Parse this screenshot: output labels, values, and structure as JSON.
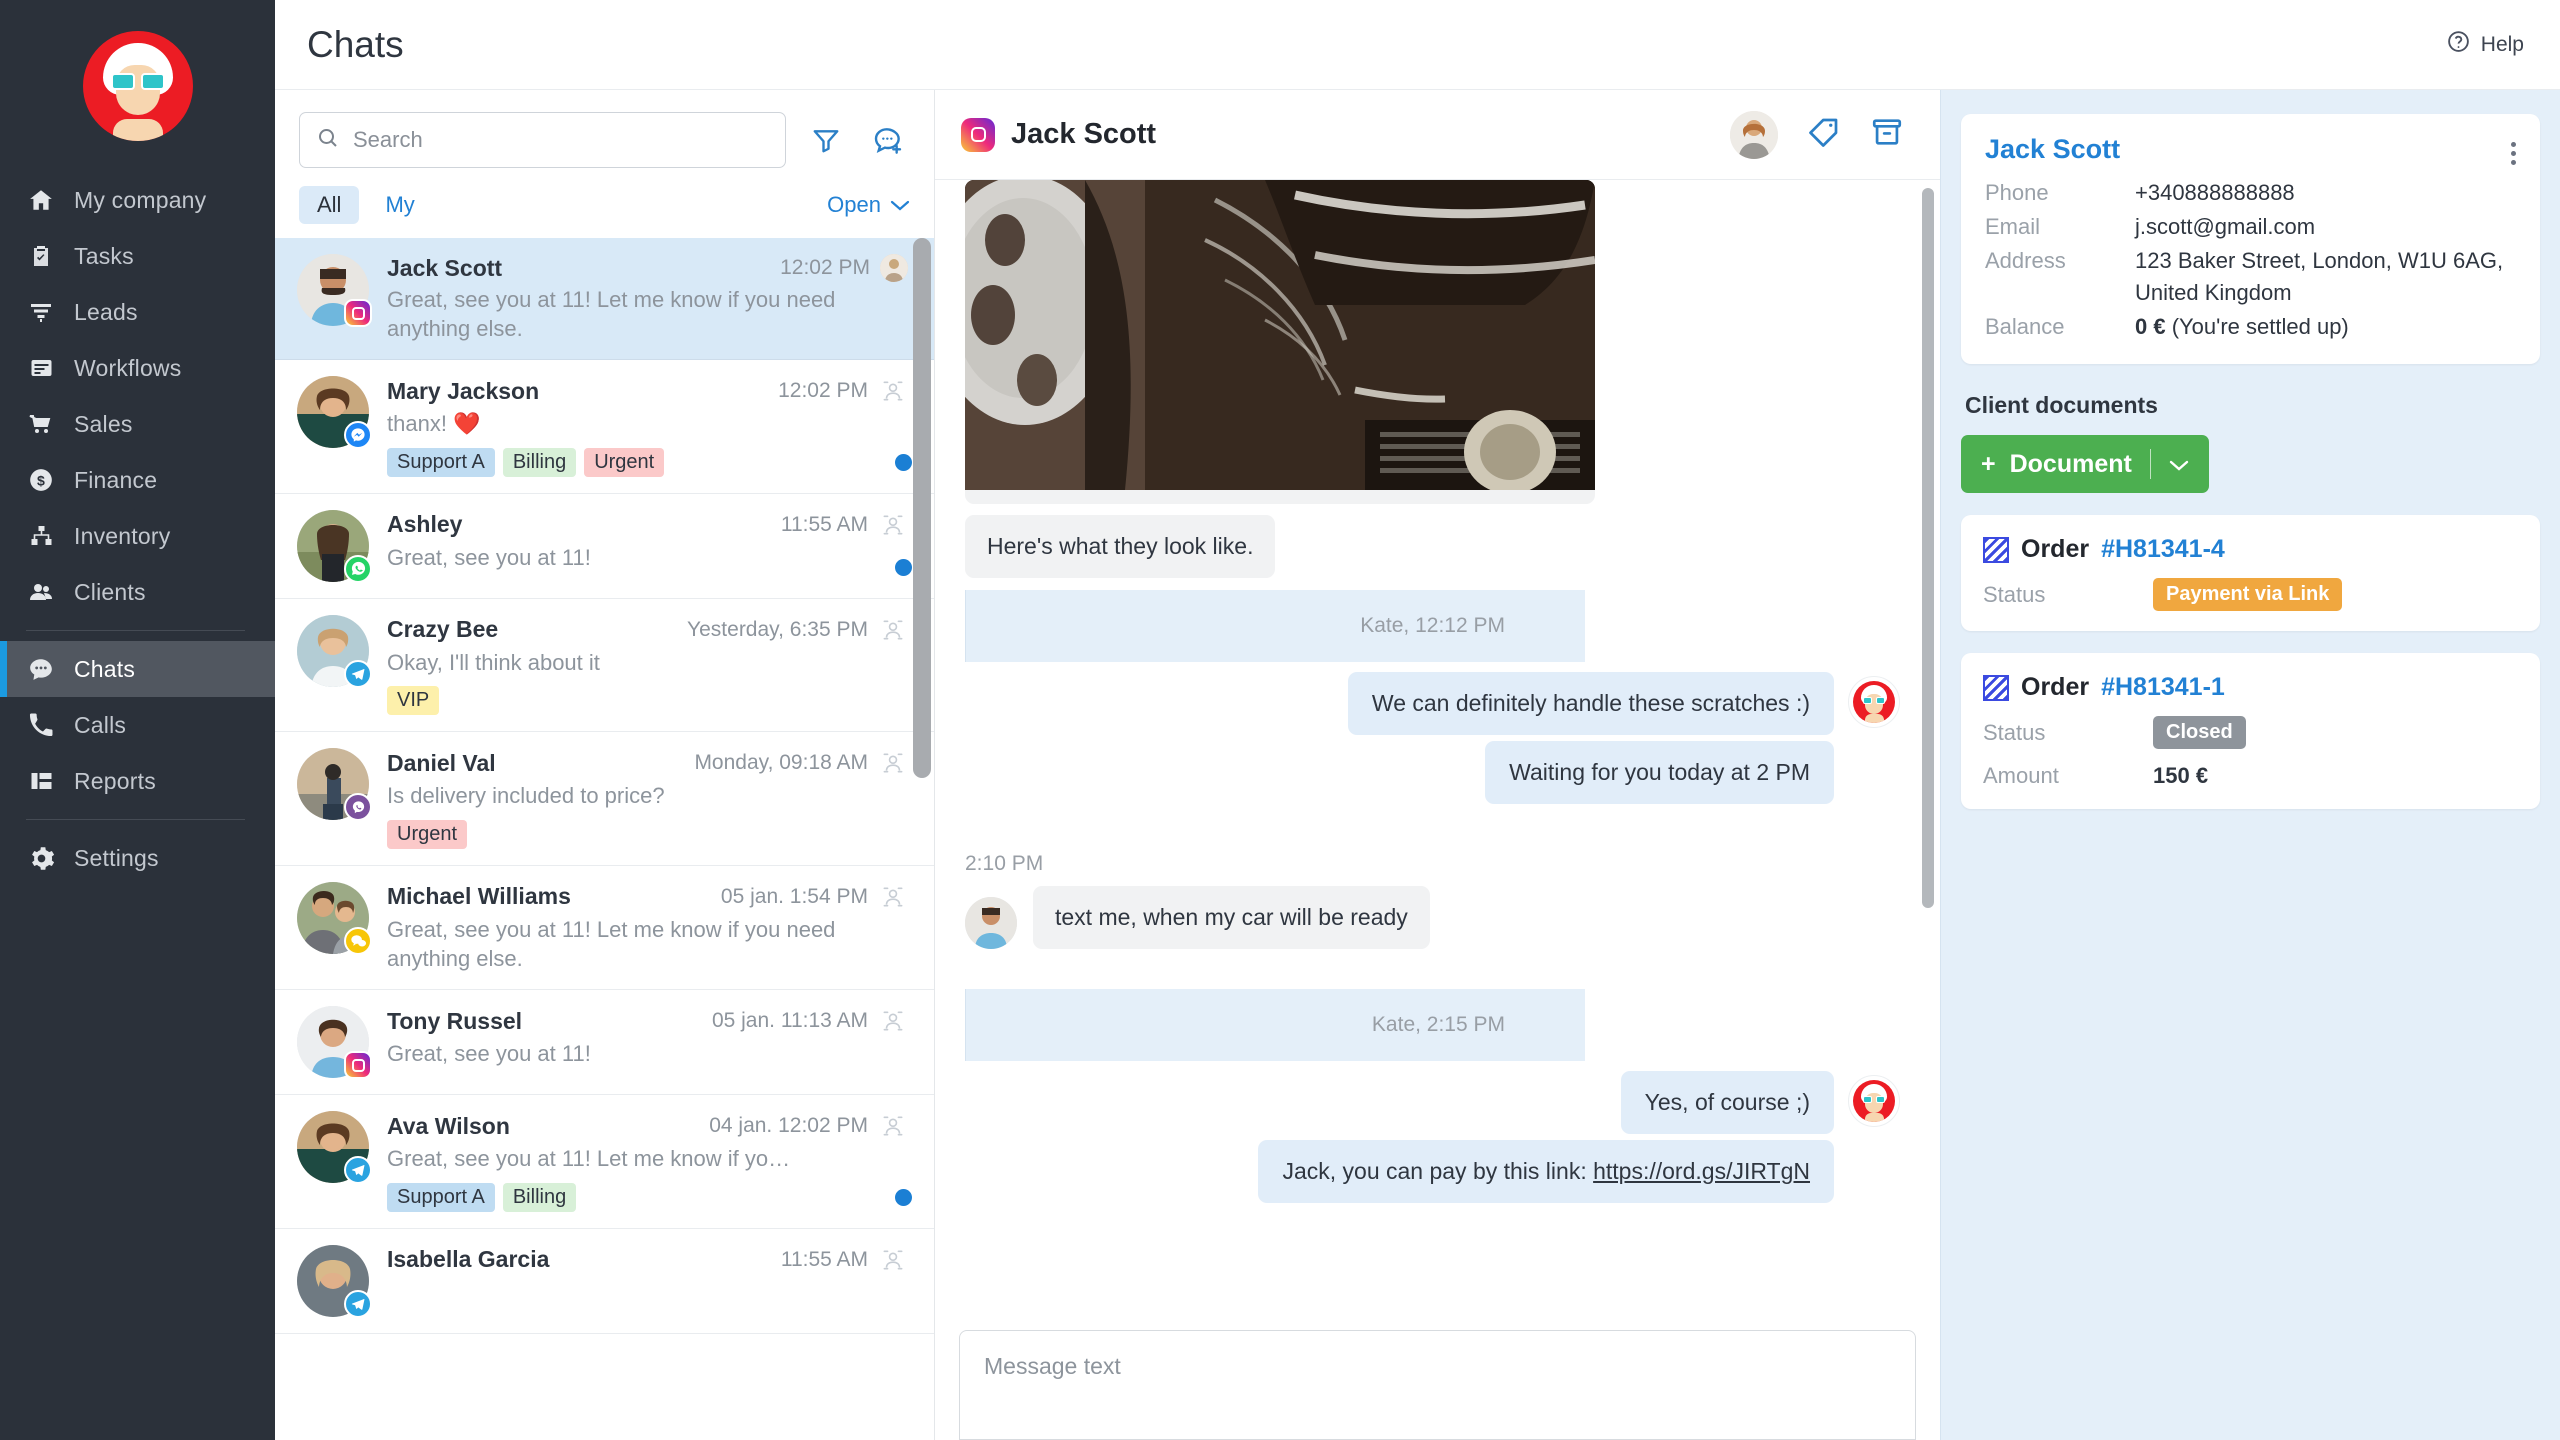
{
  "sidebar": {
    "logo_alt": "company-logo",
    "items": [
      {
        "label": "My company",
        "icon": "home-icon"
      },
      {
        "label": "Tasks",
        "icon": "clipboard-check-icon"
      },
      {
        "label": "Leads",
        "icon": "funnel-icon"
      },
      {
        "label": "Workflows",
        "icon": "flow-icon"
      },
      {
        "label": "Sales",
        "icon": "cart-icon"
      },
      {
        "label": "Finance",
        "icon": "dollar-coin-icon"
      },
      {
        "label": "Inventory",
        "icon": "boxes-icon"
      },
      {
        "label": "Clients",
        "icon": "people-icon"
      },
      {
        "label": "Chats",
        "icon": "chat-bubble-icon"
      },
      {
        "label": "Calls",
        "icon": "phone-icon"
      },
      {
        "label": "Reports",
        "icon": "report-grid-icon"
      },
      {
        "label": "Settings",
        "icon": "gear-icon"
      }
    ],
    "active": "Chats"
  },
  "topbar": {
    "title": "Chats",
    "help_label": "Help",
    "help_icon": "question-circle-icon"
  },
  "chatlist": {
    "search_placeholder": "Search",
    "search_value": "",
    "search_icon": "search-icon",
    "filter_icon": "filter-funnel-icon",
    "new_chat_icon": "new-chat-icon",
    "tab_all": "All",
    "tab_my": "My",
    "status_filter": "Open",
    "status_chevron": "chevron-down-icon",
    "rows": [
      {
        "name": "Jack Scott",
        "time": "12:02 PM",
        "preview": "Great, see you at 11! Let me know if you need anything else.",
        "channel": "instagram",
        "tags": [],
        "unread": false,
        "active": true,
        "assigned_avatar": true
      },
      {
        "name": "Mary Jackson",
        "time": "12:02 PM",
        "preview": "thanx! ❤️",
        "channel": "facebook",
        "tags": [
          {
            "label": "Support A",
            "color": "blue"
          },
          {
            "label": "Billing",
            "color": "green"
          },
          {
            "label": "Urgent",
            "color": "red"
          }
        ],
        "unread": true,
        "active": false,
        "assigned_avatar": false
      },
      {
        "name": "Ashley",
        "time": "11:55 AM",
        "preview": "Great, see you at 11!",
        "channel": "whatsapp",
        "tags": [],
        "unread": true,
        "active": false,
        "assigned_avatar": false
      },
      {
        "name": "Crazy Bee",
        "time": "Yesterday, 6:35 PM",
        "preview": "Okay, I'll think about it",
        "channel": "telegram",
        "tags": [
          {
            "label": "VIP",
            "color": "yellow"
          }
        ],
        "unread": false,
        "active": false,
        "assigned_avatar": false
      },
      {
        "name": "Daniel Val",
        "time": "Monday, 09:18 AM",
        "preview": "Is delivery included to price?",
        "channel": "viber",
        "tags": [
          {
            "label": "Urgent",
            "color": "red"
          }
        ],
        "unread": false,
        "active": false,
        "assigned_avatar": false
      },
      {
        "name": "Michael Williams",
        "time": "05 jan. 1:54 PM",
        "preview": "Great, see you at 11! Let me know if you need anything else.",
        "channel": "kakao",
        "tags": [],
        "unread": false,
        "active": false,
        "assigned_avatar": false
      },
      {
        "name": "Tony Russel",
        "time": "05 jan. 11:13 AM",
        "preview": "Great, see you at 11!",
        "channel": "instagram",
        "tags": [],
        "unread": false,
        "active": false,
        "assigned_avatar": false
      },
      {
        "name": "Ava Wilson",
        "time": "04 jan. 12:02 PM",
        "preview": "Great, see you at 11! Let me know if yo…",
        "channel": "telegram",
        "tags": [
          {
            "label": "Support A",
            "color": "blue"
          },
          {
            "label": "Billing",
            "color": "green"
          }
        ],
        "unread": true,
        "active": false,
        "assigned_avatar": false
      },
      {
        "name": "Isabella Garcia",
        "time": "11:55 AM",
        "preview": "",
        "channel": "telegram",
        "tags": [],
        "unread": false,
        "active": false,
        "assigned_avatar": false
      }
    ]
  },
  "conversation": {
    "title": "Jack Scott",
    "channel_icon": "instagram-icon",
    "assignee_avatar": "agent-avatar",
    "tag_icon": "tag-icon",
    "archive_icon": "archive-icon",
    "messages": [
      {
        "dir": "in",
        "type": "image",
        "alt": "car-bumper-scratches-photo"
      },
      {
        "dir": "in",
        "type": "text",
        "text": "Here's what they look like."
      },
      {
        "dir": "out",
        "type": "meta",
        "text": "Kate, 12:12 PM"
      },
      {
        "dir": "out",
        "type": "text",
        "text": "We can definitely handle these scratches :)"
      },
      {
        "dir": "out",
        "type": "text",
        "text": "Waiting for you today at 2 PM"
      },
      {
        "dir": "in",
        "type": "meta",
        "text": "2:10 PM"
      },
      {
        "dir": "in",
        "type": "text",
        "text": "text me,  when my car will be ready"
      },
      {
        "dir": "out",
        "type": "meta",
        "text": "Kate, 2:15 PM"
      },
      {
        "dir": "out",
        "type": "text",
        "text": "Yes, of course ;)"
      },
      {
        "dir": "out",
        "type": "link",
        "prefix": "Jack, you can pay by this link: ",
        "link": "https://ord.gs/JIRTgN"
      }
    ],
    "composer_placeholder": "Message text"
  },
  "client_panel": {
    "name": "Jack Scott",
    "menu_icon": "kebab-menu-icon",
    "fields": [
      {
        "key": "Phone",
        "value": "+340888888888"
      },
      {
        "key": "Email",
        "value": "j.scott@gmail.com"
      },
      {
        "key": "Address",
        "value": "123 Baker Street, London, W1U 6AG, United Kingdom"
      }
    ],
    "balance_key": "Balance",
    "balance_amount": "0 €",
    "balance_note": " (You're settled up)",
    "documents_title": "Client documents",
    "add_document_label": "Document",
    "add_document_plus": "+",
    "add_document_chevron": "chevron-down-icon",
    "documents": [
      {
        "type_label": "Order",
        "number": "#H81341-4",
        "icon": "document-icon",
        "rows": [
          {
            "key": "Status",
            "badge": "Payment via Link",
            "badge_color": "orange"
          }
        ]
      },
      {
        "type_label": "Order",
        "number": "#H81341-1",
        "icon": "document-icon",
        "rows": [
          {
            "key": "Status",
            "badge": "Closed",
            "badge_color": "gray"
          },
          {
            "key": "Amount",
            "value": "150 €"
          }
        ]
      }
    ]
  },
  "colors": {
    "sidebar_bg": "#2b313a",
    "accent_blue": "#2281d4",
    "active_row_bg": "#d8e9f7",
    "panel_bg": "#e4eff9",
    "green_button": "#4caf50",
    "orange_badge": "#f0a73f",
    "gray_badge": "#8e949b"
  }
}
